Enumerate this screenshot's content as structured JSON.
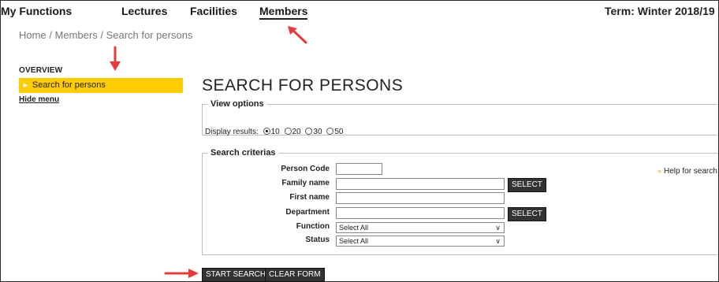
{
  "nav": {
    "items": [
      "My Functions",
      "Lectures",
      "Facilities",
      "Members"
    ],
    "active": "Members",
    "term": "Term: Winter 2018/19"
  },
  "breadcrumb": [
    "Home",
    "Members",
    "Search for persons"
  ],
  "sidebar": {
    "heading": "OVERVIEW",
    "active_item": "Search for persons",
    "hide_label": "Hide menu"
  },
  "page_title": "SEARCH FOR PERSONS",
  "view_options": {
    "legend": "View options",
    "display_label": "Display results:",
    "options": [
      "10",
      "20",
      "30",
      "50"
    ],
    "selected": "10"
  },
  "search": {
    "legend": "Search criterias",
    "person_code_label": "Person Code",
    "family_name_label": "Family name",
    "first_name_label": "First name",
    "department_label": "Department",
    "function_label": "Function",
    "status_label": "Status",
    "function_value": "Select All",
    "status_value": "Select All",
    "select_label": "SELECT",
    "help_label": "Help for search"
  },
  "actions": {
    "start_search": "START SEARCH",
    "clear_form": "CLEAR FORM"
  },
  "colors": {
    "highlight": "#ffcc00",
    "arrow": "#e63b3b",
    "button": "#333333"
  }
}
